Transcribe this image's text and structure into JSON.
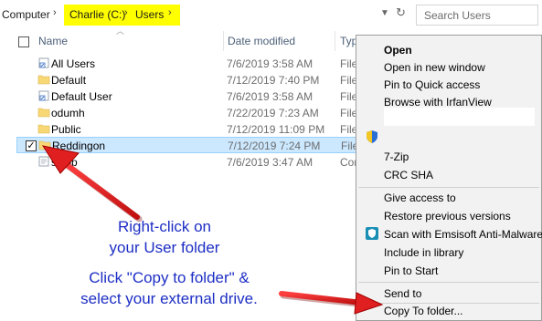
{
  "address_bar": {
    "root": "Computer",
    "path": [
      "Charlie (C:)",
      "Users"
    ],
    "search_placeholder": "Search Users"
  },
  "columns": {
    "name": "Name",
    "date": "Date modified",
    "type": "Typ"
  },
  "rows": [
    {
      "name": "All Users",
      "date": "7/6/2019 3:58 AM",
      "type": "File",
      "icon": "shortcut-folder-icon",
      "selected": false
    },
    {
      "name": "Default",
      "date": "7/12/2019 7:40 PM",
      "type": "File",
      "icon": "folder-icon",
      "selected": false
    },
    {
      "name": "Default User",
      "date": "7/6/2019 3:58 AM",
      "type": "File",
      "icon": "shortcut-folder-icon",
      "selected": false
    },
    {
      "name": "odumh",
      "date": "7/22/2019 7:23 AM",
      "type": "File",
      "icon": "folder-icon",
      "selected": false
    },
    {
      "name": "Public",
      "date": "7/12/2019 11:09 PM",
      "type": "File",
      "icon": "folder-icon",
      "selected": false
    },
    {
      "name": "Reddingon",
      "date": "7/12/2019 7:24 PM",
      "type": "File",
      "icon": "folder-icon",
      "selected": true
    },
    {
      "name": "sktop",
      "date": "7/6/2019 3:47 AM",
      "type": "Cor",
      "icon": "desktop-ini-icon",
      "selected": false
    }
  ],
  "context_menu": {
    "open": "Open",
    "open_new_window": "Open in new window",
    "pin_quick_access": "Pin to Quick access",
    "browse_irfanview": "Browse with IrfanView",
    "seven_zip": "7-Zip",
    "crc_sha": "CRC SHA",
    "give_access": "Give access to",
    "restore_versions": "Restore previous versions",
    "scan_emsisoft": "Scan with Emsisoft Anti-Malware",
    "include_library": "Include in library",
    "pin_start": "Pin to Start",
    "send_to": "Send to",
    "copy_to_folder": "Copy To folder..."
  },
  "annotations": {
    "right_click_line1": "Right-click on",
    "right_click_line2": "your User folder",
    "copy_line1": "Click \"Copy to folder\" &",
    "copy_line2": "select your external drive."
  },
  "colors": {
    "highlight": "#ffff00",
    "selected_row": "#cce8ff",
    "arrow_red": "#e02020",
    "annotation_blue": "#1d2ec4",
    "menu_bg": "#f2f2f2"
  }
}
